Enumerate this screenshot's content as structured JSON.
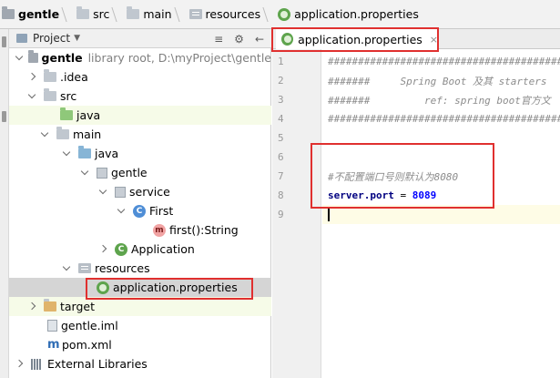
{
  "breadcrumbs": [
    {
      "label": "gentle",
      "icon": "project-folder-icon"
    },
    {
      "label": "src",
      "icon": "folder-icon"
    },
    {
      "label": "main",
      "icon": "folder-icon"
    },
    {
      "label": "resources",
      "icon": "resources-folder-icon"
    },
    {
      "label": "application.properties",
      "icon": "spring-properties-icon"
    }
  ],
  "project_panel": {
    "title": "Project",
    "tools": [
      "≡",
      "⚙",
      "←"
    ]
  },
  "tree": {
    "root_name": "gentle",
    "root_meta": "library root,  D:\\myProject\\gentle",
    "idea": ".idea",
    "src": "src",
    "java_top": "java",
    "main": "main",
    "java": "java",
    "gentle_pkg": "gentle",
    "service": "service",
    "first_class": "First",
    "first_method": "first():String",
    "application": "Application",
    "resources": "resources",
    "app_props": "application.properties",
    "target": "target",
    "gentle_iml": "gentle.iml",
    "pom": "pom.xml",
    "external_libs": "External Libraries"
  },
  "editor": {
    "tab_label": "application.properties",
    "tab_close": "×",
    "line_numbers": [
      "1",
      "2",
      "3",
      "4",
      "5",
      "6",
      "7",
      "8",
      "9"
    ],
    "lines": {
      "l1": "##############################################",
      "l2": "#######     Spring Boot 及其 starters",
      "l3": "#######         ref: spring boot官方文",
      "l4": "##############################################",
      "l7": "#不配置端口号则默认为8080",
      "l8_key": "server.port",
      "l8_eq": " = ",
      "l8_val": "8089"
    }
  },
  "colors": {
    "highlight_box": "#e0302f",
    "selection": "#d5d5d5",
    "spring_green": "#5ea44d"
  }
}
